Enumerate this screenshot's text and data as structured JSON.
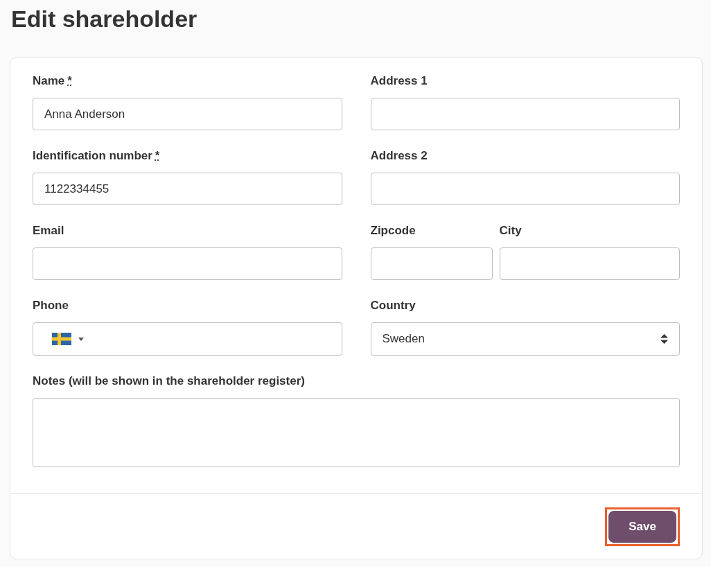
{
  "title": "Edit shareholder",
  "required_marker": "*",
  "rows": [
    {
      "fields": [
        {
          "kind": "text",
          "label": "Name",
          "required": true,
          "value": "Anna Anderson"
        },
        {
          "kind": "text",
          "label": "Address 1",
          "required": false
        }
      ]
    },
    {
      "fields": [
        {
          "kind": "text",
          "label": "Identification number",
          "required": true,
          "value": "1122334455"
        },
        {
          "kind": "text",
          "label": "Address 2",
          "required": false
        }
      ]
    },
    {
      "fields": [
        {
          "kind": "text",
          "label": "Email",
          "required": false
        },
        {
          "kind": "text",
          "label": "Zipcode",
          "required": false
        },
        {
          "kind": "text",
          "label": "City",
          "required": false
        }
      ]
    },
    {
      "fields": [
        {
          "kind": "phone",
          "label": "Phone",
          "required": false
        },
        {
          "kind": "select",
          "label": "Country",
          "required": false,
          "value": "Sweden"
        }
      ]
    },
    {
      "fields": [
        {
          "kind": "textarea",
          "label": "Notes (will be shown in the shareholder register)",
          "required": false
        }
      ]
    }
  ],
  "save_button": {
    "label": "Save",
    "highlighted": true
  }
}
